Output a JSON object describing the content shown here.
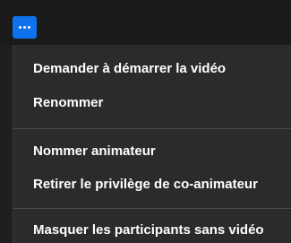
{
  "toolbar": {
    "more_button_icon": "ellipsis-icon",
    "accent_color": "#0e72ed"
  },
  "menu": {
    "items": [
      {
        "label": "Demander à démarrer la vidéo"
      },
      {
        "label": "Renommer"
      },
      {
        "label": "Nommer animateur"
      },
      {
        "label": "Retirer le privilège de co-animateur"
      },
      {
        "label": "Masquer les participants sans vidéo"
      }
    ]
  }
}
